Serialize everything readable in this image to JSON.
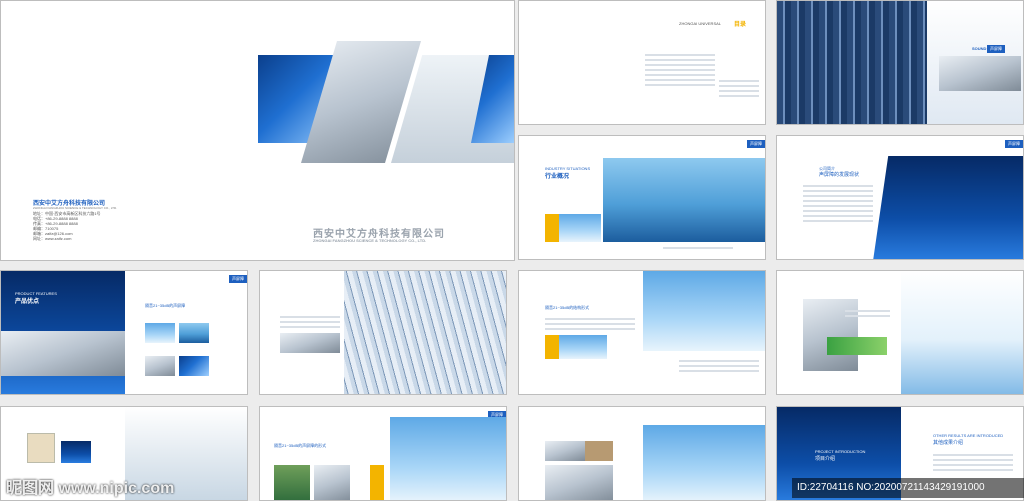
{
  "cover": {
    "company_cn": "西安中艾方舟科技有限公司",
    "company_en": "ZHONGAI FANGZHOU  SCIENCE & TECHNOLOGY CO., LTD.",
    "contact_lines": [
      "地址：中国·西安市高新区科技六路1号",
      "电话：+86-29-8888 8888",
      "传真：+86-29-8888 8888",
      "邮编：710075",
      "邮箱：zaifz@126.com",
      "网址：www.zaifz.com"
    ],
    "logo_cn": "西安中艾方舟科技有限公司",
    "logo_en": "ZHONGAI FANGZHOU  SCIENCE & TECHNOLOGY CO., LTD."
  },
  "contents": {
    "brand": "ZHONGAI UNIVERSAL",
    "title_cn": "目录"
  },
  "sound_label": "SOUND",
  "sound_label_cn": "声屏障",
  "industry": {
    "en": "INDUSTRY SITUATIONS",
    "cn": "行业概况"
  },
  "company": {
    "en": "公司简介",
    "cn": "声屏障的发展现状"
  },
  "product": {
    "en": "PRODUCT FEATURES",
    "cn": "产品优点"
  },
  "section_a": "隔音21~35dB的声屏障",
  "section_b": "隔音21~35dB的结构形式",
  "section_c": "隔音21~35dB的声屏障的形式",
  "results": {
    "en": "OTHER RESULTS ARE INTRODUCED",
    "cn": "其他成果介绍"
  },
  "project": {
    "en": "PROJECT INTRODUCTION",
    "cn": "项目介绍"
  },
  "watermark": "昵图网 www.nipic.com",
  "image_id": "ID:22704116 NO:20200721143429191000",
  "colors": {
    "accent": "#1d5fbf",
    "yellow": "#f3b400"
  }
}
